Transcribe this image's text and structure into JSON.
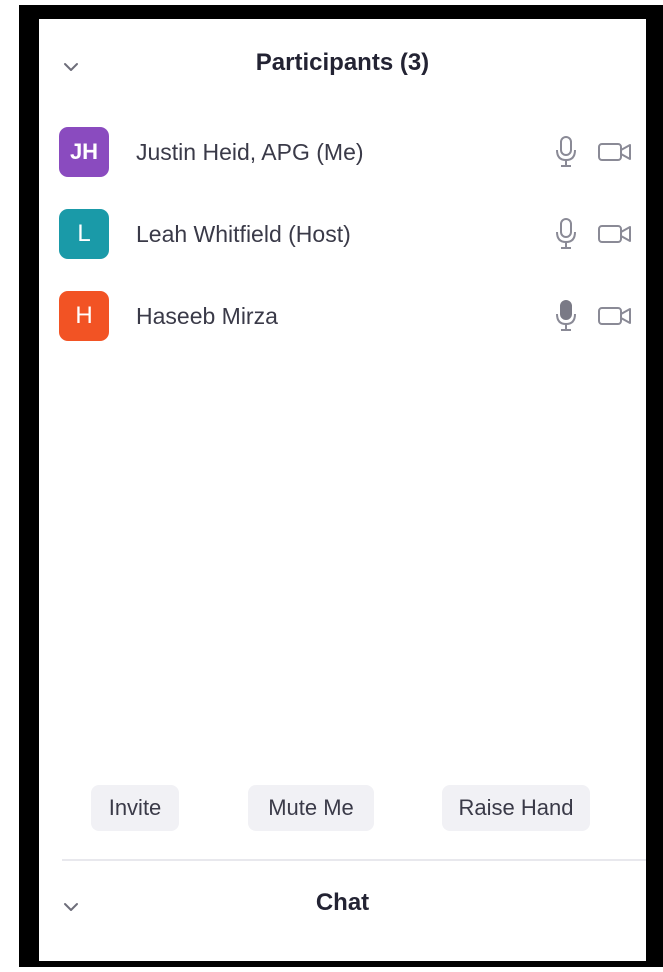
{
  "participants_panel": {
    "title": "Participants (3)",
    "collapse_icon": "chevron-down-icon"
  },
  "participants": [
    {
      "initials": "JH",
      "name": "Justin Heid, APG (Me)",
      "avatar_color": "#8a4bbf",
      "mic": "mic-outline-icon",
      "camera": "video-camera-icon"
    },
    {
      "initials": "L",
      "name": "Leah Whitfield (Host)",
      "avatar_color": "#1a9aa8",
      "mic": "mic-outline-icon",
      "camera": "video-camera-icon"
    },
    {
      "initials": "H",
      "name": "Haseeb Mirza",
      "avatar_color": "#f25324",
      "mic": "mic-filled-icon",
      "camera": "video-camera-icon"
    }
  ],
  "actions": {
    "invite_label": "Invite",
    "mute_label": "Mute Me",
    "raise_hand_label": "Raise Hand"
  },
  "chat_panel": {
    "title": "Chat",
    "collapse_icon": "chevron-down-icon"
  },
  "colors": {
    "text_primary": "#232333",
    "button_bg": "#f1f1f5"
  }
}
